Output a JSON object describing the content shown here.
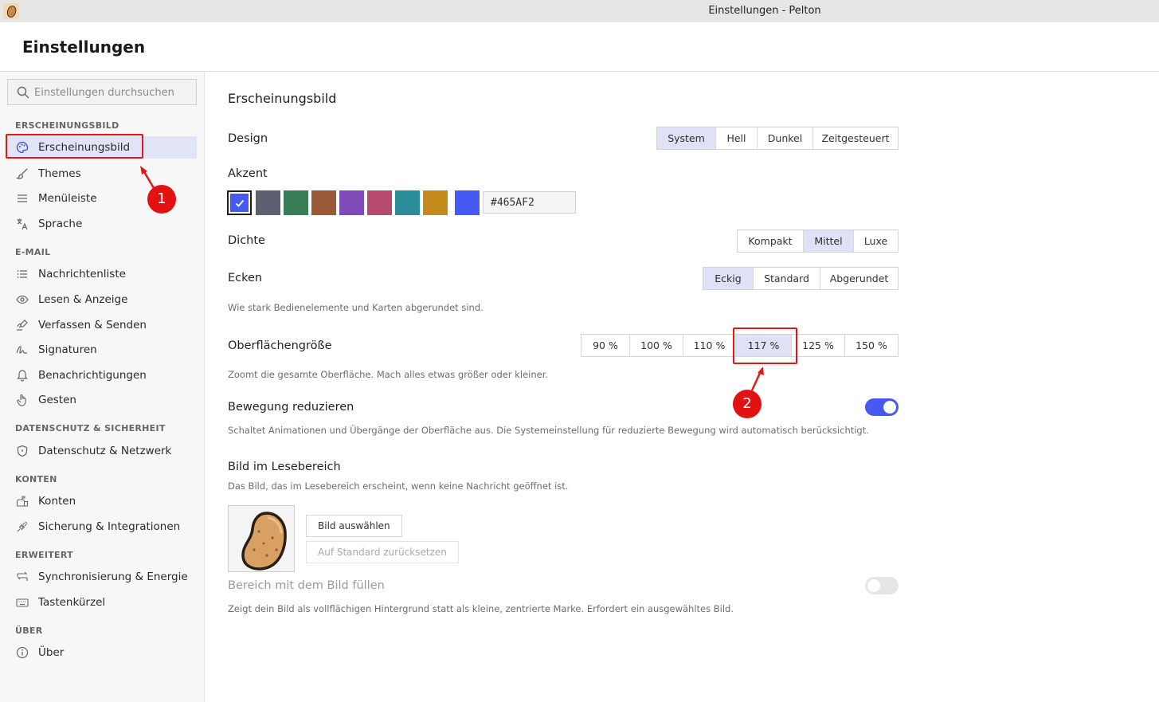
{
  "window": {
    "title": "Einstellungen - Pelton",
    "app_icon": "potato-icon"
  },
  "header": {
    "title": "Einstellungen"
  },
  "sidebar": {
    "search_placeholder": "Einstellungen durchsuchen",
    "sections": {
      "appearance": "ERSCHEINUNGSBILD",
      "email": "E-MAIL",
      "privacy": "DATENSCHUTZ & SICHERHEIT",
      "accounts": "KONTEN",
      "advanced": "ERWEITERT",
      "about": "ÜBER"
    },
    "items": {
      "appearance": "Erscheinungsbild",
      "themes": "Themes",
      "menubar": "Menüleiste",
      "language": "Sprache",
      "message_list": "Nachrichtenliste",
      "reading": "Lesen & Anzeige",
      "compose": "Verfassen & Senden",
      "signatures": "Signaturen",
      "notifications": "Benachrichtigungen",
      "gestures": "Gesten",
      "privacy_network": "Datenschutz & Netzwerk",
      "accounts": "Konten",
      "security_integrations": "Sicherung & Integrationen",
      "sync_energy": "Synchronisierung & Energie",
      "shortcuts": "Tastenkürzel",
      "about": "Über"
    },
    "active_item": "Erscheinungsbild"
  },
  "main": {
    "section_title": "Erscheinungsbild",
    "design": {
      "label": "Design",
      "options": [
        "System",
        "Hell",
        "Dunkel",
        "Zeitgesteuert"
      ],
      "selected": "System"
    },
    "accent": {
      "label": "Akzent",
      "swatches": [
        "#465af2",
        "#5c6070",
        "#3a7d59",
        "#9a5a3a",
        "#7e4bb8",
        "#b8496f",
        "#2b8c9a",
        "#c48a1c",
        "#465af2"
      ],
      "selected_index": 0,
      "hex_value": "#465AF2"
    },
    "density": {
      "label": "Dichte",
      "options": [
        "Kompakt",
        "Mittel",
        "Luxe"
      ],
      "selected": "Mittel"
    },
    "corners": {
      "label": "Ecken",
      "options": [
        "Eckig",
        "Standard",
        "Abgerundet"
      ],
      "selected": "Eckig",
      "hint": "Wie stark Bedienelemente und Karten abgerundet sind."
    },
    "ui_size": {
      "label": "Oberflächengröße",
      "options": [
        "90 %",
        "100 %",
        "110 %",
        "117 %",
        "125 %",
        "150 %"
      ],
      "selected": "117 %",
      "hint": "Zoomt die gesamte Oberfläche. Mach alles etwas größer oder kleiner."
    },
    "reduce_motion": {
      "label": "Bewegung reduzieren",
      "enabled": true,
      "hint": "Schaltet Animationen und Übergänge der Oberfläche aus. Die Systemeinstellung für reduzierte Bewegung wird automatisch berücksichtigt."
    },
    "reading_image": {
      "label": "Bild im Lesebereich",
      "hint": "Das Bild, das im Lesebereich erscheint, wenn keine Nachricht geöffnet ist.",
      "choose_label": "Bild auswählen",
      "reset_label": "Auf Standard zurücksetzen",
      "fill_label": "Bereich mit dem Bild füllen",
      "fill_enabled": false,
      "fill_hint": "Zeigt dein Bild als vollflächigen Hintergrund statt als kleine, zentrierte Marke. Erfordert ein ausgewähltes Bild."
    }
  },
  "annotations": {
    "first": "1",
    "second": "2",
    "color": "#e01818"
  }
}
